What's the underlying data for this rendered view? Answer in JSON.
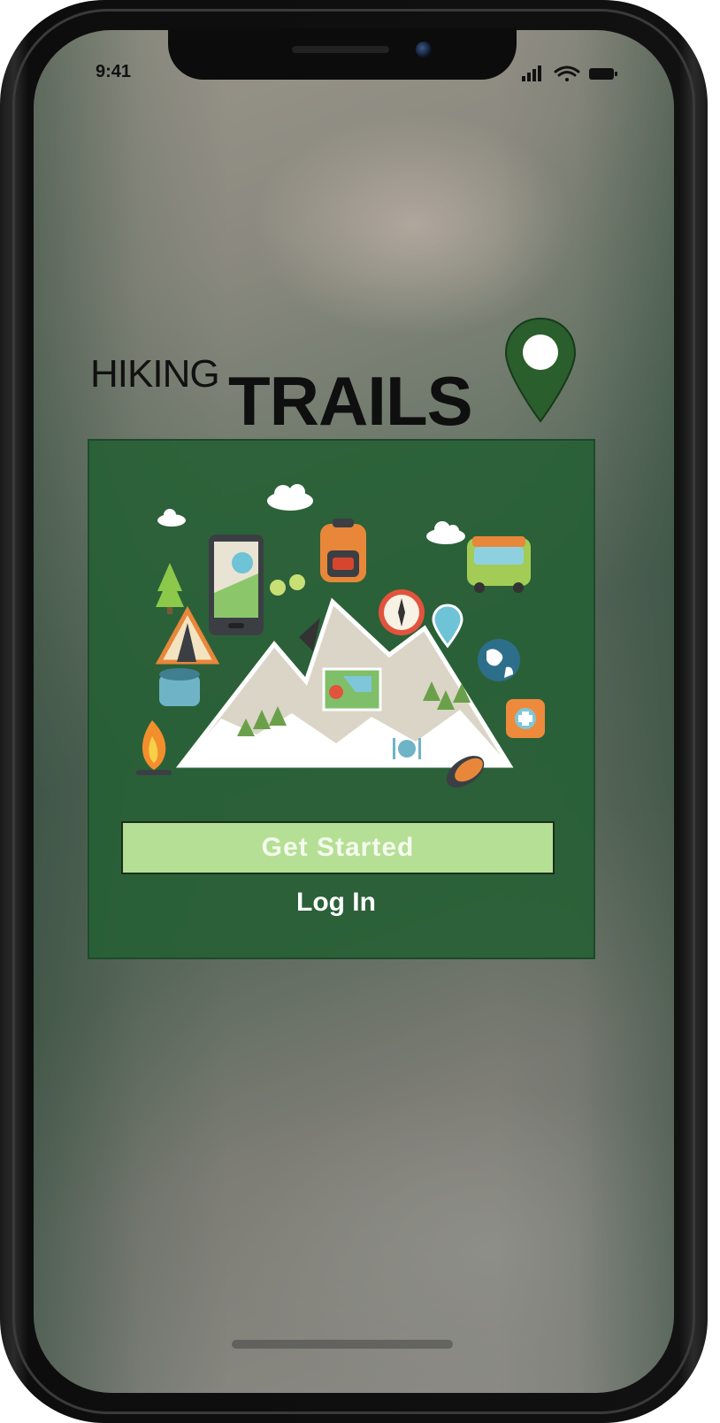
{
  "status_bar": {
    "time": "9:41"
  },
  "brand": {
    "line1": "HIKING",
    "line2": "TRAILS"
  },
  "actions": {
    "get_started_label": "Get Started",
    "login_label": "Log In"
  },
  "colors": {
    "brand_green": "#236032",
    "button_green": "#b5df94",
    "pin_green": "#2a5e2c"
  },
  "icons": [
    "location-pin-icon",
    "signal-icon",
    "wifi-icon",
    "battery-icon",
    "mountain-illustration"
  ]
}
